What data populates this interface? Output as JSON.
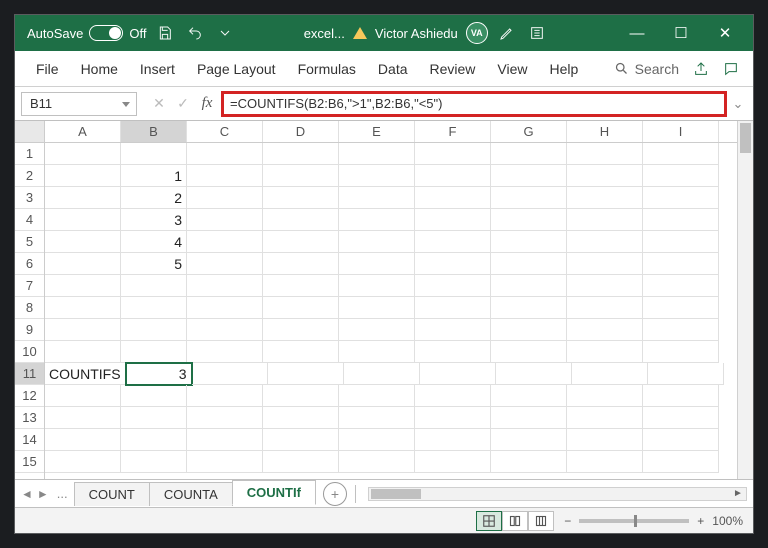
{
  "titlebar": {
    "autosave_label": "AutoSave",
    "autosave_state": "Off",
    "filename": "excel...",
    "username": "Victor Ashiedu",
    "avatar_initials": "VA"
  },
  "ribbon_tabs": [
    "File",
    "Home",
    "Insert",
    "Page Layout",
    "Formulas",
    "Data",
    "Review",
    "View",
    "Help"
  ],
  "search_label": "Search",
  "namebox": "B11",
  "formula": "=COUNTIFS(B2:B6,\">1\",B2:B6,\"<5\")",
  "columns": [
    "A",
    "B",
    "C",
    "D",
    "E",
    "F",
    "G",
    "H",
    "I"
  ],
  "rows": [
    "1",
    "2",
    "3",
    "4",
    "5",
    "6",
    "7",
    "8",
    "9",
    "10",
    "11",
    "12",
    "13",
    "14",
    "15"
  ],
  "selected_cell": {
    "row": 11,
    "col": "B"
  },
  "cells": {
    "A11": "COUNTIFS",
    "B2": "1",
    "B3": "2",
    "B4": "3",
    "B5": "4",
    "B6": "5",
    "B11": "3"
  },
  "sheet_tabs": {
    "hidden_indicator": "...",
    "tabs": [
      "COUNT",
      "COUNTA",
      "COUNTIf"
    ],
    "active": "COUNTIf"
  },
  "zoom": "100%",
  "colors": {
    "excel_green": "#1e6f46",
    "highlight_red": "#d32323"
  }
}
